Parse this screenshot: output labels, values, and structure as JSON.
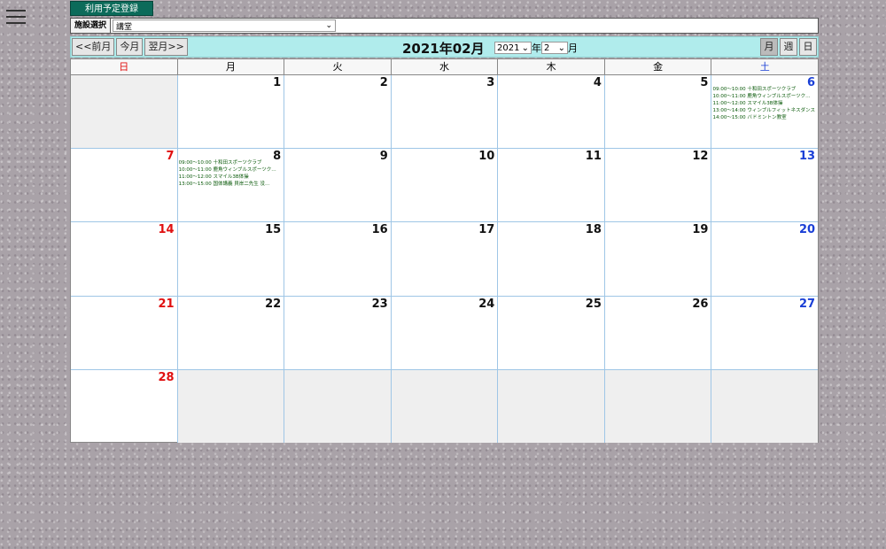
{
  "header": {
    "register_label": "利用予定登録",
    "facility_label": "施設選択",
    "facility_value": "講堂"
  },
  "toolbar": {
    "prev_label": "<<前月",
    "today_label": "今月",
    "next_label": "翌月>>",
    "title": "2021年02月",
    "year_value": "2021",
    "year_suffix": "年",
    "month_value": "2",
    "month_suffix": "月",
    "view_month": "月",
    "view_week": "週",
    "view_day": "日"
  },
  "weekdays": [
    "日",
    "月",
    "火",
    "水",
    "木",
    "金",
    "土"
  ],
  "weeks": [
    [
      "",
      "1",
      "2",
      "3",
      "4",
      "5",
      "6"
    ],
    [
      "7",
      "8",
      "9",
      "10",
      "11",
      "12",
      "13"
    ],
    [
      "14",
      "15",
      "16",
      "17",
      "18",
      "19",
      "20"
    ],
    [
      "21",
      "22",
      "23",
      "24",
      "25",
      "26",
      "27"
    ],
    [
      "28",
      "",
      "",
      "",
      "",
      "",
      ""
    ]
  ],
  "events": {
    "d6": [
      "09:00～10:00 十和田スポーツクラブ",
      "10:00～11:00 鹿角ウィンブルスポーツク…",
      "11:00～12:00 スマイル3B体操",
      "13:00～14:00 ウィンブルフィットネスダンス",
      "14:00～15:00 バドミントン教室"
    ],
    "d8": [
      "09:00～10:00 十和田スポーツクラブ",
      "10:00～11:00 鹿角ウィンブルスポーツク…",
      "11:00～12:00 スマイル3B体操",
      "13:00～15:00 国体講義 貝岸二先生 没…"
    ]
  }
}
